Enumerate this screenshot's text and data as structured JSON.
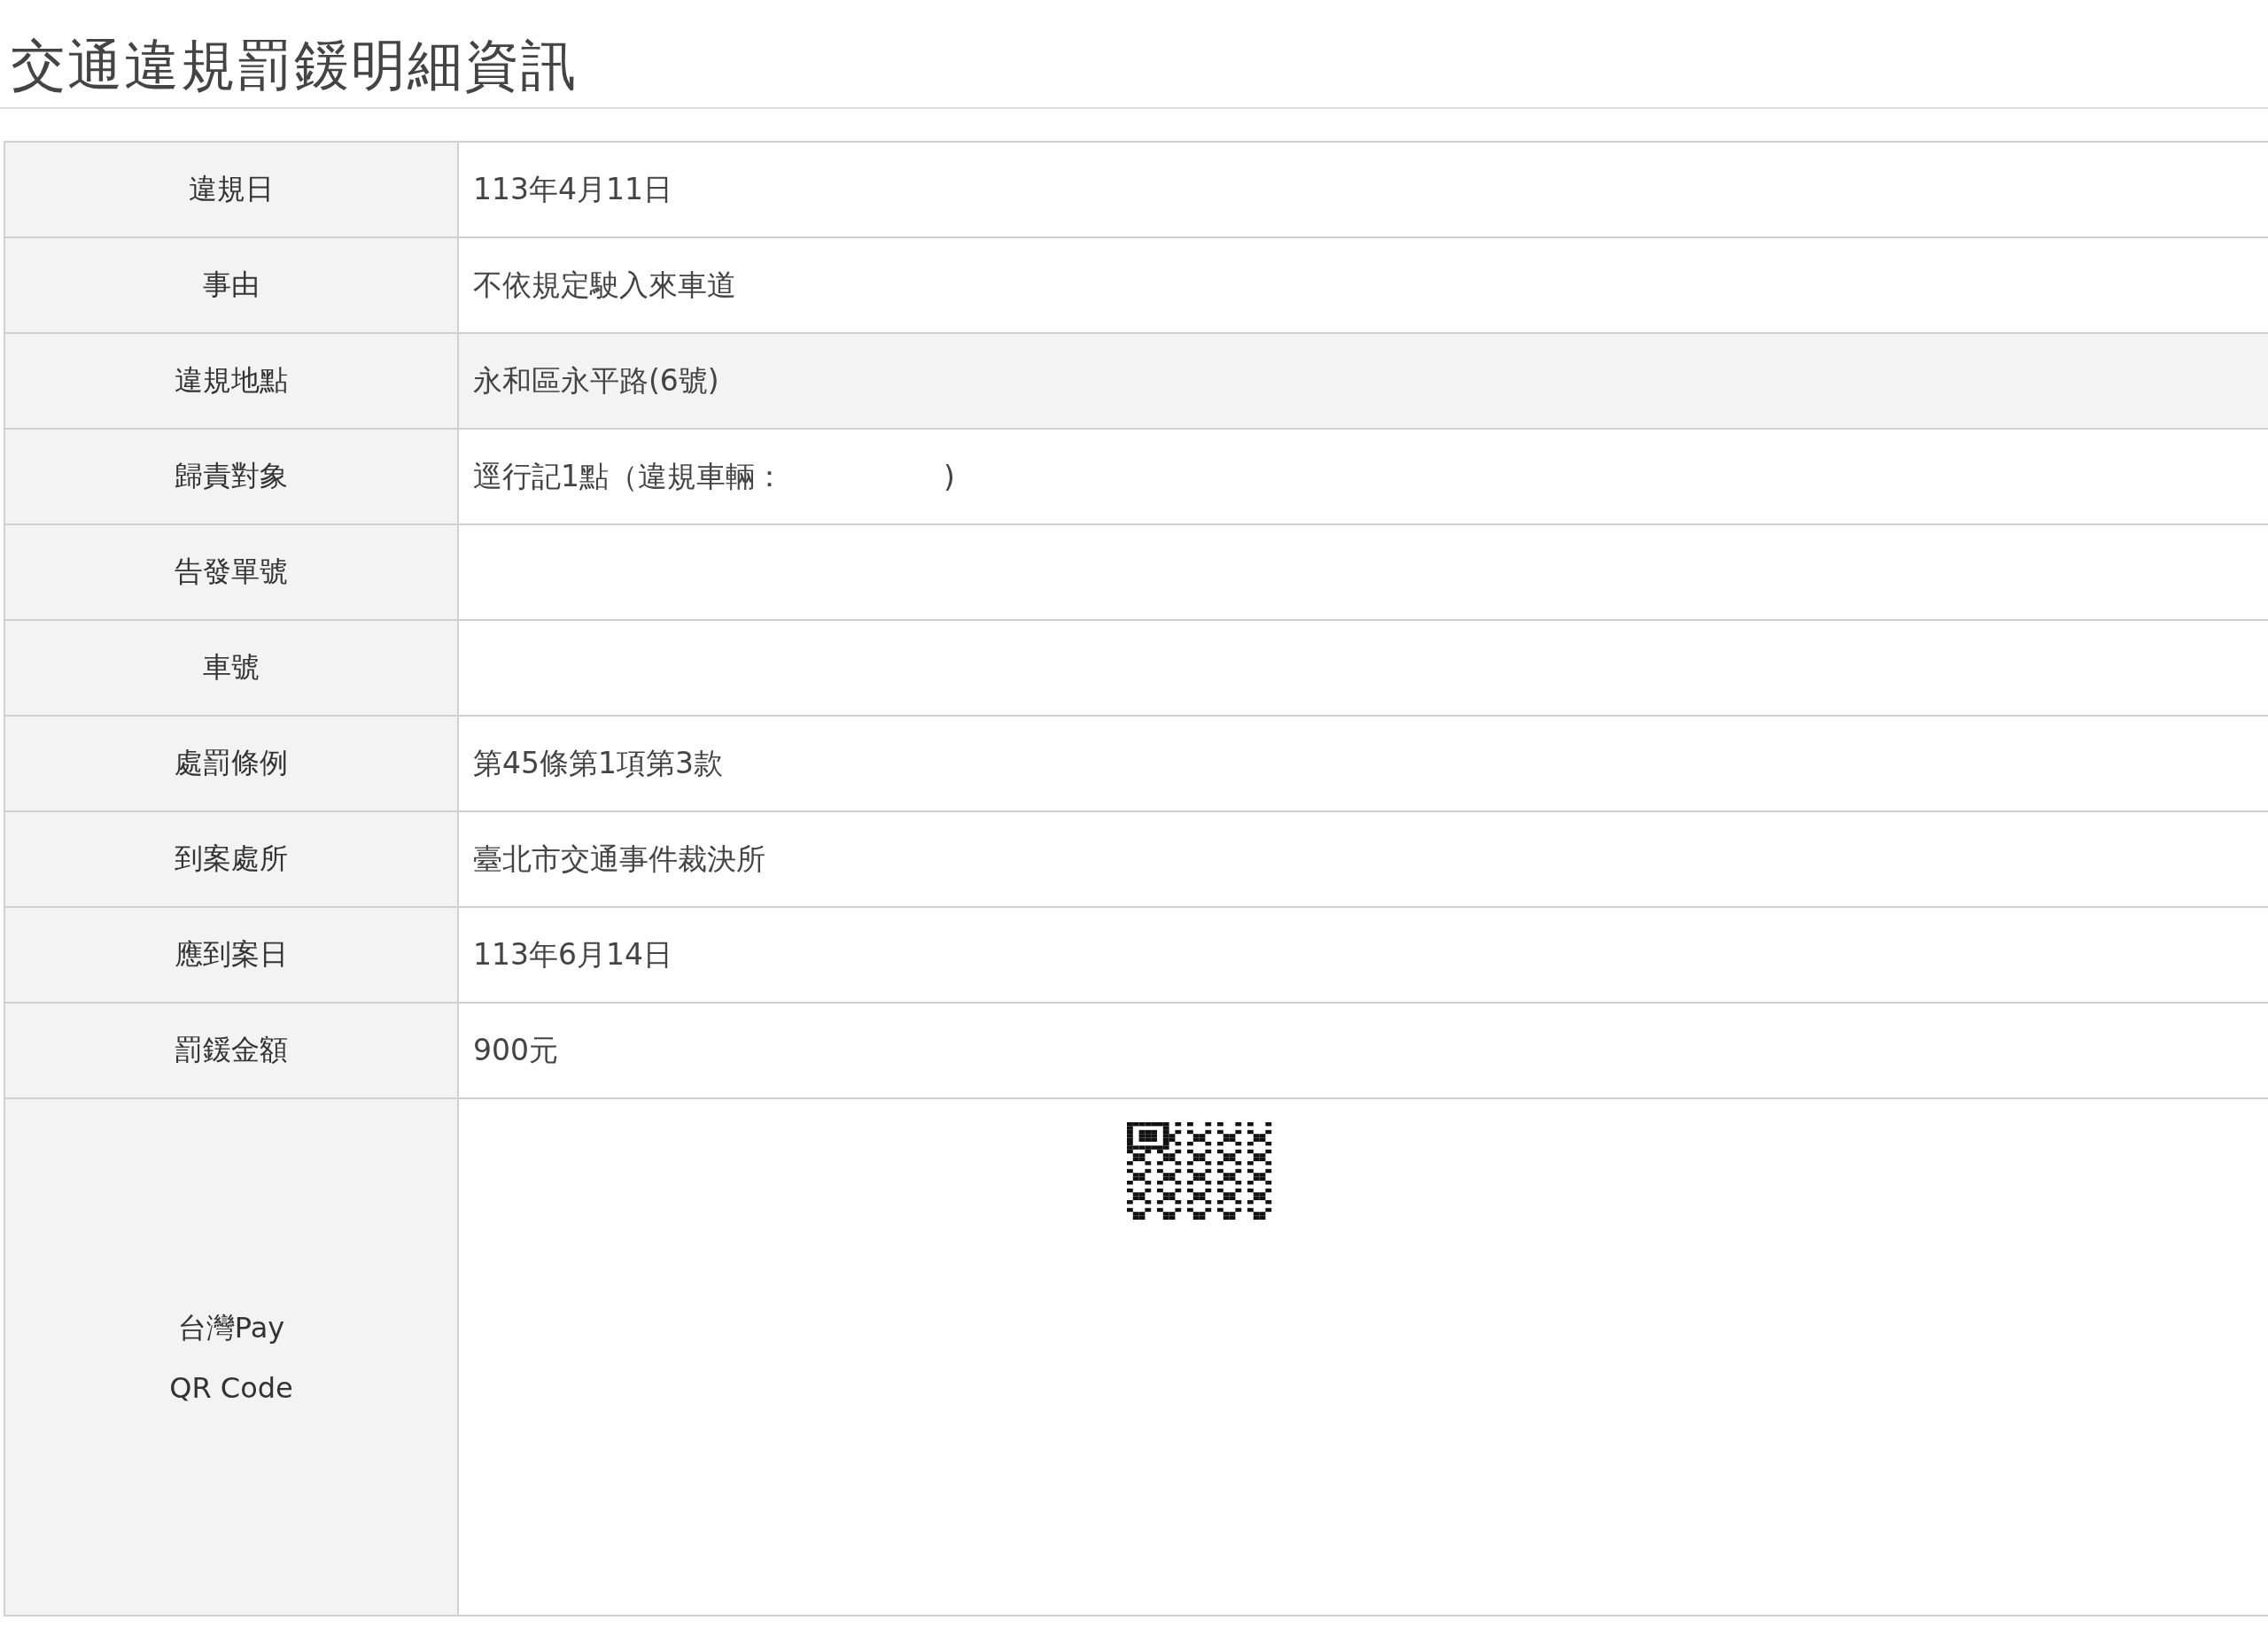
{
  "title": "交通違規罰鍰明細資訊",
  "rows": [
    {
      "kind": "text",
      "label": "違規日",
      "value": "113年4月11日",
      "highlighted": false
    },
    {
      "kind": "text",
      "label": "事由",
      "value": "不依規定駛入來車道",
      "highlighted": false
    },
    {
      "kind": "text",
      "label": "違規地點",
      "value": "永和區永平路(6號)",
      "highlighted": true
    },
    {
      "kind": "text",
      "label": "歸責對象",
      "value": "逕行記1點（違規車輛：",
      "value_end": ")",
      "highlighted": false
    },
    {
      "kind": "text",
      "label": "告發單號",
      "highlighted": false
    },
    {
      "kind": "text",
      "label": "車號",
      "highlighted": false
    },
    {
      "kind": "text",
      "label": "處罰條例",
      "value": "第45條第1項第3款",
      "highlighted": false
    },
    {
      "kind": "text",
      "label": "到案處所",
      "value": "臺北市交通事件裁決所",
      "highlighted": false
    },
    {
      "kind": "text",
      "label": "應到案日",
      "value": "113年6月14日",
      "highlighted": false
    },
    {
      "kind": "text",
      "label": "罰鍰金額",
      "value": "900元",
      "highlighted": false
    },
    {
      "kind": "qr",
      "label_lines": [
        "台灣Pay",
        "QR Code"
      ]
    }
  ]
}
